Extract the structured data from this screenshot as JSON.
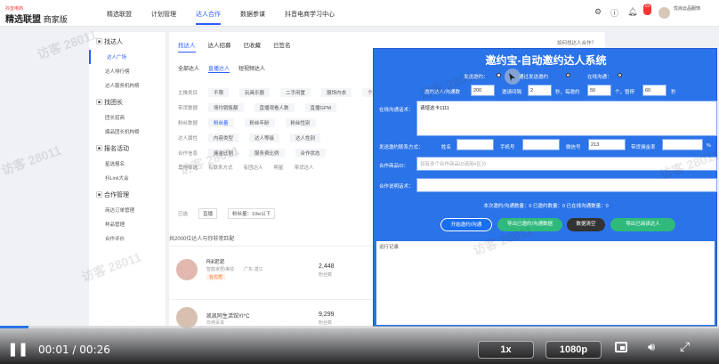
{
  "header": {
    "logo_small": "抖音电商",
    "logo_main": "精选联盟",
    "logo_sub": "商家版",
    "nav": [
      "精选联盟",
      "计划管理",
      "达人合作",
      "数据参谋",
      "抖音电商学习中心"
    ],
    "nav_active": 2,
    "notif_count": "15",
    "user_name": "优尚云品服饰"
  },
  "sidebar": {
    "groups": [
      {
        "label": "找达人",
        "items": [
          "达人广场",
          "达人排行榜",
          "达人服务机构榜"
        ]
      },
      {
        "label": "找团长",
        "items": [
          "团长招商",
          "爆品团长机构榜"
        ]
      },
      {
        "label": "报名活动",
        "items": [
          "星选报名",
          "抖Link大会"
        ]
      },
      {
        "label": "合作管理",
        "items": [
          "商达订单管理",
          "样品管理",
          "合作评价"
        ]
      }
    ],
    "active_item": "达人广场"
  },
  "content": {
    "tabs": [
      "找达人",
      "达人招募",
      "已收藏",
      "已签名"
    ],
    "help": "如何找达人合作？",
    "subtabs": [
      "全部达人",
      "直播达人",
      "短视频达人"
    ],
    "filters": [
      {
        "label": "主推类目",
        "chips": [
          "不限",
          "玩具乐器",
          "二手闲置",
          "服饰内衣",
          "个护"
        ]
      },
      {
        "label": "带货数据",
        "chips": [
          "场均销售额",
          "直播观看人数",
          "直播GPM"
        ]
      },
      {
        "label": "粉丝数据",
        "chips": [
          "粉丝量",
          "粉丝年龄",
          "粉丝性别"
        ]
      },
      {
        "label": "达人属性",
        "chips": [
          "内容类型",
          "达人等级",
          "达人性别"
        ]
      },
      {
        "label": "合作信息",
        "chips": [
          "佣金比例",
          "服务费比例",
          "合作状态"
        ]
      },
      {
        "label": "其他筛选",
        "chips": [
          "有联系方式",
          "有团达人",
          "明星",
          "带货达人"
        ]
      }
    ],
    "selected_label": "已选",
    "selected": [
      "直播",
      "粉丝量：10w以下"
    ],
    "result_count": "共2000位达人与你非常匹配",
    "rows": [
      {
        "name": "Rili泥泥",
        "sub": "智能家居/美妆",
        "tag": "有优质",
        "extra": "广东-湛江",
        "fans": "2,448",
        "fans_label": "粉丝数"
      },
      {
        "name": "凯凯阿生活馆YI°C",
        "sub": "日用百货",
        "tag": "",
        "extra": "",
        "fans": "9,299",
        "fans_label": "粉丝数"
      },
      {
        "name": "星瑶七彩日用品",
        "sub": "",
        "tag": "",
        "extra": "",
        "fans": "1,157",
        "fans_label": "粉丝数"
      }
    ]
  },
  "panel": {
    "title": "邀约宝-自动邀约达人系统",
    "mode_label": "发送邀约：",
    "mode_option_1": "通过发送邀约",
    "mode_option_2": "在线沟通：",
    "count_label": "邀约达人/沟通数",
    "count_value": "200",
    "interval_label": "邀请间隔",
    "interval_value": "2",
    "interval_unit": "秒，每邀约",
    "batch_value": "50",
    "batch_unit": "个，暂停",
    "pause_value": "60",
    "pause_unit": "秒",
    "message_label": "在线沟通话术：",
    "message_value": "请增这卡1111",
    "contact_label": "发送邀约联系方式：",
    "name_label": "姓名",
    "name_value": "",
    "phone_label": "手机号",
    "phone_value": "",
    "wechat_label": "微信号",
    "wechat_value": "213",
    "commission_label": "带货佣金率",
    "commission_value": "",
    "commission_unit": "%",
    "product_label": "合作商品ID：",
    "product_placeholder": "如有多个合作商品ID请用#区分",
    "note_label": "合作说明话术：",
    "status": "本次邀约/沟通数量：0    已邀约数量：0    已在线沟通数量：0",
    "buttons": [
      "开始邀约/沟通",
      "导出已邀约/沟通数据",
      "数据清空",
      "导出已阅读达人"
    ],
    "log_label": "运行记录"
  },
  "watermark": "访客 28011",
  "player": {
    "current": "00:01",
    "separator": "/",
    "duration": "00:26",
    "progress": 0.04,
    "speed": "1x",
    "quality": "1080p"
  }
}
